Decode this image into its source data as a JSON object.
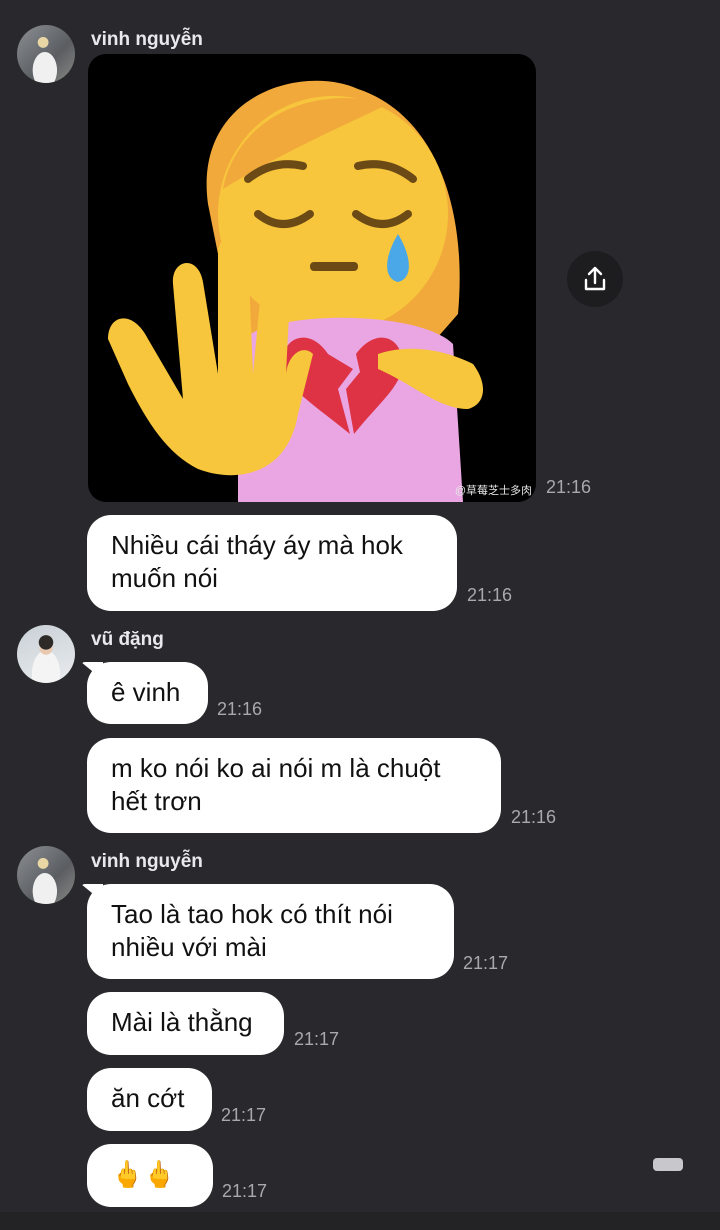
{
  "colors": {
    "background": "#29292d",
    "bubble": "#ffffff",
    "bubble_text": "#111111",
    "timestamp": "#a8a8ad"
  },
  "messages": [
    {
      "id": "m0",
      "sender": "vinh nguyễn",
      "type": "image",
      "image_icon": "crying-girl-stop-hand-broken-heart-emoji",
      "watermark": "@草莓芝士多肉",
      "time": "21:16"
    },
    {
      "id": "m1",
      "sender": "vinh nguyễn",
      "type": "text",
      "lines": [
        "Nhiều cái tháy áy mà hok",
        "muốn nói"
      ],
      "time": "21:16"
    },
    {
      "id": "m2",
      "sender": "vũ đặng",
      "type": "text",
      "lines": [
        "ê vinh"
      ],
      "time": "21:16"
    },
    {
      "id": "m3",
      "sender": "vũ đặng",
      "type": "text",
      "lines": [
        "m ko nói ko ai nói m là chuột",
        "hết trơn"
      ],
      "time": "21:16"
    },
    {
      "id": "m4",
      "sender": "vinh nguyễn",
      "type": "text",
      "lines": [
        "Tao là tao hok có thít nói",
        "nhiều với mài"
      ],
      "time": "21:17"
    },
    {
      "id": "m5",
      "sender": "vinh nguyễn",
      "type": "text",
      "lines": [
        "Mài là thằng"
      ],
      "time": "21:17"
    },
    {
      "id": "m6",
      "sender": "vinh nguyễn",
      "type": "text",
      "lines": [
        "ăn cớt"
      ],
      "time": "21:17"
    },
    {
      "id": "m7",
      "sender": "vinh nguyễn",
      "type": "text",
      "lines": [
        "🖕🖕"
      ],
      "time": "21:17"
    }
  ],
  "share_button": {
    "icon": "share-upload-icon"
  }
}
